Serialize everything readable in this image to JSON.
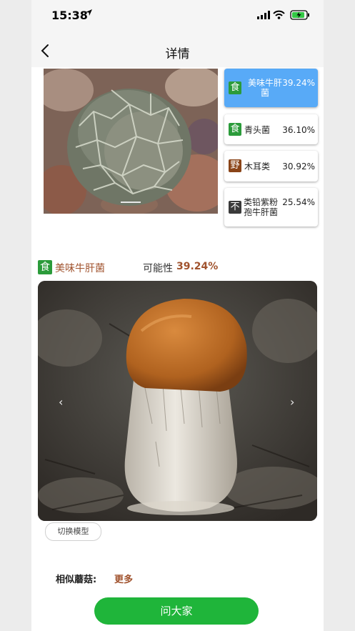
{
  "status_bar": {
    "time": "15:38"
  },
  "header": {
    "title": "详情"
  },
  "candidates": [
    {
      "badge": "食",
      "name": "美味牛肝菌",
      "percent": "39.24%",
      "selected": true
    },
    {
      "badge": "食",
      "name": "青头菌",
      "percent": "36.10%",
      "selected": false
    },
    {
      "badge": "野",
      "name": "木耳类",
      "percent": "30.92%",
      "selected": false
    },
    {
      "badge": "不",
      "name": "类铅紫粉孢牛肝菌",
      "percent": "25.54%",
      "selected": false
    }
  ],
  "result": {
    "badge": "食",
    "name": "美味牛肝菌",
    "possibility_label": "可能性",
    "possibility_value": "39.24%"
  },
  "switch_model_label": "切换模型",
  "similar": {
    "label": "相似蘑菇:",
    "more_label": "更多"
  },
  "ask_button_label": "问大家",
  "colors": {
    "accent_blue": "#58aaf7",
    "green": "#1fb53a",
    "brown_text": "#a0522d"
  }
}
